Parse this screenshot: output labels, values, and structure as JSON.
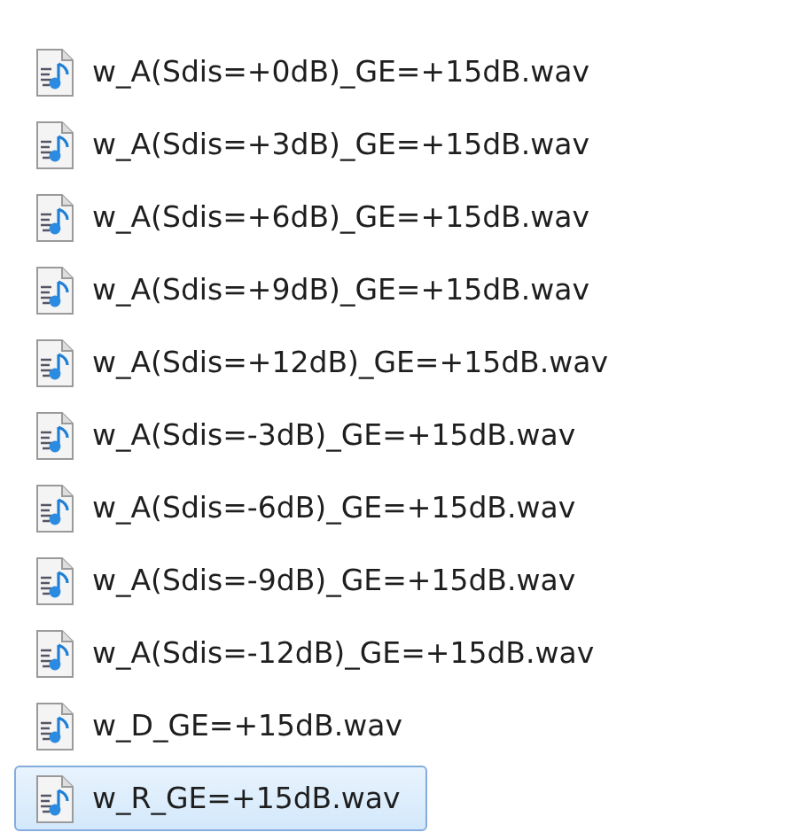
{
  "files": [
    {
      "name": "w_A(Sdis=+0dB)_GE=+15dB.wav",
      "selected": false
    },
    {
      "name": "w_A(Sdis=+3dB)_GE=+15dB.wav",
      "selected": false
    },
    {
      "name": "w_A(Sdis=+6dB)_GE=+15dB.wav",
      "selected": false
    },
    {
      "name": "w_A(Sdis=+9dB)_GE=+15dB.wav",
      "selected": false
    },
    {
      "name": "w_A(Sdis=+12dB)_GE=+15dB.wav",
      "selected": false
    },
    {
      "name": "w_A(Sdis=-3dB)_GE=+15dB.wav",
      "selected": false
    },
    {
      "name": "w_A(Sdis=-6dB)_GE=+15dB.wav",
      "selected": false
    },
    {
      "name": "w_A(Sdis=-9dB)_GE=+15dB.wav",
      "selected": false
    },
    {
      "name": "w_A(Sdis=-12dB)_GE=+15dB.wav",
      "selected": false
    },
    {
      "name": "w_D_GE=+15dB.wav",
      "selected": false
    },
    {
      "name": "w_R_GE=+15dB.wav",
      "selected": true
    }
  ]
}
